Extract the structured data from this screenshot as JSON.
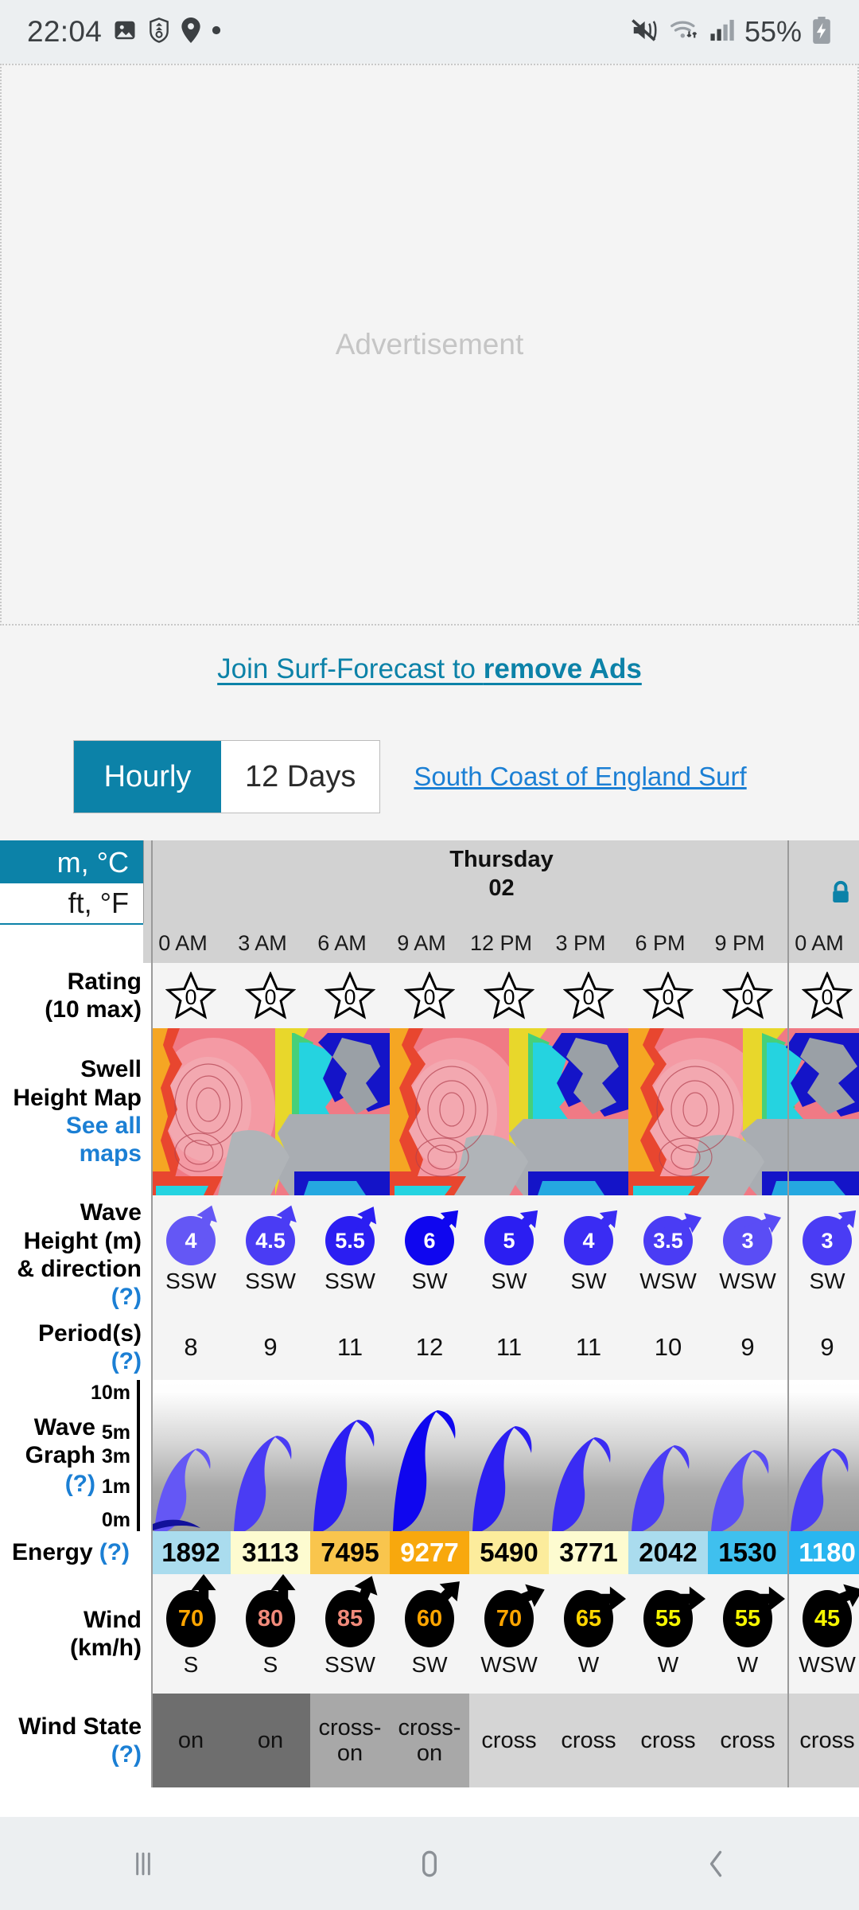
{
  "status_bar": {
    "time": "22:04",
    "battery_percent": "55%",
    "icons": [
      "image-icon",
      "shield-icon",
      "location-pin-icon",
      "dot-icon",
      "mute-icon",
      "wifi-icon",
      "signal-icon",
      "battery-charging-icon"
    ]
  },
  "ad": {
    "label": "Advertisement"
  },
  "promo": {
    "text_plain": "Join Surf-Forecast to ",
    "text_bold": "remove Ads"
  },
  "tabs": {
    "hourly_label": "Hourly",
    "days_label": "12 Days",
    "active": "Hourly",
    "spot_link": "South Coast of England Surf"
  },
  "units": {
    "metric": "m, °C",
    "imperial": "ft, °F",
    "selected": "m, °C"
  },
  "row_labels": {
    "rating": "Rating",
    "rating_sub": "(10 max)",
    "swell_map": "Swell",
    "swell_map2": "Height Map",
    "swell_map_link": "See all",
    "swell_map_link2": "maps",
    "wave": "Wave",
    "wave2": "Height (m)",
    "wave3": "& direction",
    "period": "Period(s)",
    "graph": "Wave",
    "graph2": "Graph",
    "energy": "Energy",
    "wind": "Wind",
    "wind2": "(km/h)",
    "wind_state": "Wind State",
    "help": "(?)"
  },
  "day": {
    "name": "Thursday",
    "date": "02",
    "locked": true
  },
  "chart_data": {
    "type": "table",
    "title": "South Coast of England Surf — Hourly Forecast",
    "categories": [
      "0 AM",
      "3 AM",
      "6 AM",
      "9 AM",
      "12 PM",
      "3 PM",
      "6 PM",
      "9 PM",
      "0 AM"
    ],
    "series": [
      {
        "name": "Rating (10 max)",
        "values": [
          0,
          0,
          0,
          0,
          0,
          0,
          0,
          0,
          0
        ]
      },
      {
        "name": "Wave Height (m)",
        "values": [
          4,
          4.5,
          5.5,
          6,
          5,
          4,
          3.5,
          3,
          3
        ]
      },
      {
        "name": "Wave direction",
        "values": [
          "SSW",
          "SSW",
          "SSW",
          "SW",
          "SW",
          "SW",
          "WSW",
          "WSW",
          "SW"
        ]
      },
      {
        "name": "Period (s)",
        "values": [
          8,
          9,
          11,
          12,
          11,
          11,
          10,
          9,
          9
        ]
      },
      {
        "name": "Energy",
        "values": [
          1892,
          3113,
          7495,
          9277,
          5490,
          3771,
          2042,
          1530,
          1180
        ]
      },
      {
        "name": "Wind (km/h)",
        "values": [
          70,
          80,
          85,
          60,
          70,
          65,
          55,
          55,
          45
        ]
      },
      {
        "name": "Wind direction",
        "values": [
          "S",
          "S",
          "SSW",
          "SW",
          "WSW",
          "W",
          "W",
          "W",
          "WSW"
        ]
      },
      {
        "name": "Wind State",
        "values": [
          "on",
          "on",
          "cross-on",
          "cross-on",
          "cross",
          "cross",
          "cross",
          "cross",
          "cross"
        ]
      }
    ],
    "ylabel": "Wave Graph (m)",
    "ylim": [
      0,
      10
    ],
    "yticks": [
      "10m",
      "5m",
      "3m",
      "1m",
      "0m"
    ]
  },
  "columns": [
    {
      "hour": "0 AM",
      "rating": "0",
      "wave": "4",
      "wave_dir": "SSW",
      "period": "8",
      "energy": "1892",
      "energy_bg": "#aadcee",
      "energy_fg": "#000000",
      "wind": "70",
      "wind_dir": "S",
      "wind_fg": "#ffa500",
      "wind_rot": 0,
      "state": "on",
      "state_bg": "#6e6e6e",
      "wave_h_pct": 45,
      "wave_color": "#6457f5",
      "wave_rot": 20
    },
    {
      "hour": "3 AM",
      "rating": "0",
      "wave": "4.5",
      "wave_dir": "SSW",
      "period": "9",
      "energy": "3113",
      "energy_bg": "#fdfbd0",
      "energy_fg": "#000000",
      "wind": "80",
      "wind_dir": "S",
      "wind_fg": "#f08a7a",
      "wind_rot": 0,
      "state": "on",
      "state_bg": "#6e6e6e",
      "wave_h_pct": 53,
      "wave_color": "#4a3cf4",
      "wave_rot": 20
    },
    {
      "hour": "6 AM",
      "rating": "0",
      "wave": "5.5",
      "wave_dir": "SSW",
      "period": "11",
      "energy": "7495",
      "energy_bg": "#fbc košice",
      "energy_fg": "#000000",
      "wind": "85",
      "wind_dir": "SSW",
      "wind_fg": "#f08a7a",
      "wind_rot": 22,
      "state": "cross-on",
      "state_bg": "#a8a8a8",
      "wave_h_pct": 66,
      "wave_color": "#2b1ef2",
      "wave_rot": 28
    },
    {
      "hour": "9 AM",
      "rating": "0",
      "wave": "6",
      "wave_dir": "SW",
      "period": "12",
      "energy": "9277",
      "energy_bg": "#f8a80d",
      "energy_fg": "#ffffff",
      "wind": "60",
      "wind_dir": "SW",
      "wind_fg": "#ffa500",
      "wind_rot": 45,
      "state": "cross-on",
      "state_bg": "#a8a8a8",
      "wave_h_pct": 74,
      "wave_color": "#0f06ef",
      "wave_rot": 45
    },
    {
      "hour": "12 PM",
      "rating": "0",
      "wave": "5",
      "wave_dir": "SW",
      "period": "11",
      "energy": "5490",
      "energy_bg": "#fcec9c",
      "energy_fg": "#000000",
      "wind": "70",
      "wind_dir": "WSW",
      "wind_fg": "#ffa500",
      "wind_rot": 68,
      "state": "cross",
      "state_bg": "#d5d5d5",
      "wave_h_pct": 62,
      "wave_color": "#2b1ef2",
      "wave_rot": 45
    },
    {
      "hour": "3 PM",
      "rating": "0",
      "wave": "4",
      "wave_dir": "SW",
      "period": "11",
      "energy": "3771",
      "energy_bg": "#fdfbd0",
      "energy_fg": "#000000",
      "wind": "65",
      "wind_dir": "W",
      "wind_fg": "#ffd400",
      "wind_rot": 90,
      "state": "cross",
      "state_bg": "#d5d5d5",
      "wave_h_pct": 55,
      "wave_color": "#3a2cf3",
      "wave_rot": 45
    },
    {
      "hour": "6 PM",
      "rating": "0",
      "wave": "3.5",
      "wave_dir": "WSW",
      "period": "10",
      "energy": "2042",
      "energy_bg": "#aadcee",
      "energy_fg": "#000000",
      "wind": "55",
      "wind_dir": "W",
      "wind_fg": "#f5f500",
      "wind_rot": 90,
      "state": "cross",
      "state_bg": "#d5d5d5",
      "wave_h_pct": 50,
      "wave_color": "#4a3cf4",
      "wave_rot": 68
    },
    {
      "hour": "9 PM",
      "rating": "0",
      "wave": "3",
      "wave_dir": "WSW",
      "period": "9",
      "energy": "1530",
      "energy_bg": "#3fc0ee",
      "energy_fg": "#000000",
      "wind": "55",
      "wind_dir": "W",
      "wind_fg": "#f5f500",
      "wind_rot": 90,
      "state": "cross",
      "state_bg": "#d5d5d5",
      "wave_h_pct": 46,
      "wave_color": "#5a4df5",
      "wave_rot": 68
    },
    {
      "hour": "0 AM",
      "rating": "0",
      "wave": "3",
      "wave_dir": "SW",
      "period": "9",
      "energy": "1180",
      "energy_bg": "#29b6f0",
      "energy_fg": "#ffffff",
      "wind": "45",
      "wind_dir": "WSW",
      "wind_fg": "#f5f500",
      "wind_rot": 68,
      "state": "cross",
      "state_bg": "#d5d5d5",
      "wave_h_pct": 46,
      "wave_color": "#4a3cf4",
      "wave_rot": 45
    }
  ],
  "nav": {
    "recents": "recents-icon",
    "home": "home-icon",
    "back": "back-icon"
  },
  "colors": {
    "accent": "#0c82a8",
    "link": "#1b7fd4",
    "day_header_bg": "#d2d2d2"
  }
}
